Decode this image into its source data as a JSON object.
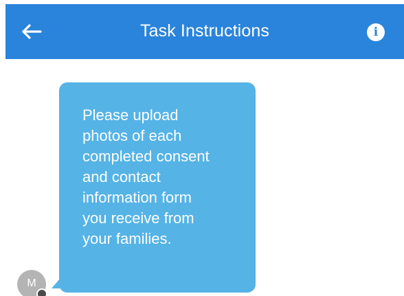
{
  "header": {
    "title": "Task Instructions",
    "back_icon": "arrow-left-icon",
    "info_icon": "info-icon",
    "background_color": "#2a84db"
  },
  "message": {
    "text": "Please upload\nphotos of each\ncompleted consent\nand contact\ninformation form\nyou receive from\nyour families.",
    "bubble_color": "#55b3e6"
  },
  "sender": {
    "avatar_initial": "M"
  }
}
